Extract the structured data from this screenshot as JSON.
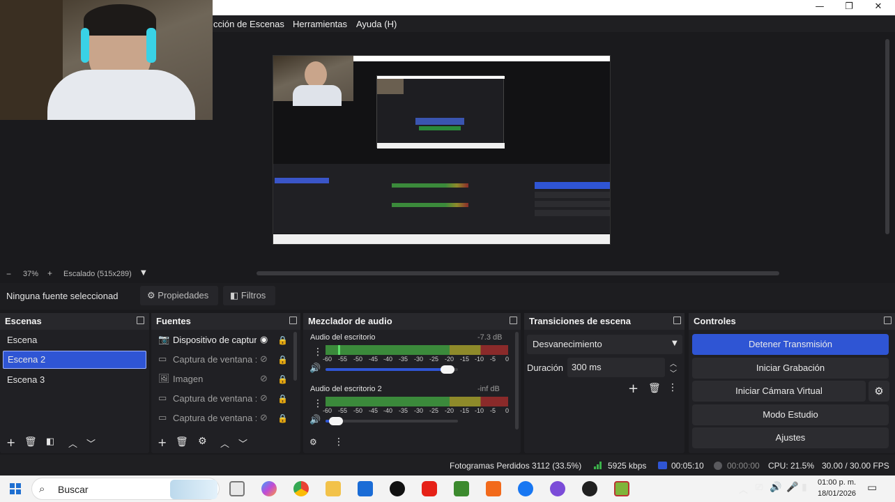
{
  "window": {
    "minimize": "—",
    "restore": "❐",
    "close": "✕"
  },
  "menu": {
    "items": [
      "cción de Escenas",
      "Herramientas",
      "Ayuda (H)"
    ]
  },
  "zoom": {
    "minus": "−",
    "level": "37%",
    "plus": "+",
    "scale": "Escalado (515x289)"
  },
  "source_toolbar": {
    "selected": "Ninguna fuente seleccionad",
    "properties": "Propiedades",
    "filters": "Filtros"
  },
  "scenes": {
    "title": "Escenas",
    "items": [
      "Escena",
      "Escena 2",
      "Escena 3"
    ],
    "selected_index": 1
  },
  "sources": {
    "title": "Fuentes",
    "items": [
      {
        "label": "Dispositivo de captur",
        "icon": "camera-icon",
        "visible": true
      },
      {
        "label": "Captura de ventana :",
        "icon": "window-icon",
        "visible": false
      },
      {
        "label": "Imagen",
        "icon": "image-icon",
        "visible": false
      },
      {
        "label": "Captura de ventana :",
        "icon": "window-icon",
        "visible": false
      },
      {
        "label": "Captura de ventana :",
        "icon": "window-icon",
        "visible": false
      }
    ]
  },
  "mixer": {
    "title": "Mezclador de audio",
    "channels": [
      {
        "name": "Audio del escritorio",
        "db": "-7.3 dB",
        "level": 0.07,
        "volume": 0.92
      },
      {
        "name": "Audio del escritorio 2",
        "db": "-inf dB",
        "level": 0.0,
        "volume": 0.08
      }
    ],
    "scale": [
      "-60",
      "-55",
      "-50",
      "-45",
      "-40",
      "-35",
      "-30",
      "-25",
      "-20",
      "-15",
      "-10",
      "-5",
      "0"
    ]
  },
  "transitions": {
    "title": "Transiciones de escena",
    "selected": "Desvanecimiento",
    "duration_label": "Duración",
    "duration_value": "300 ms"
  },
  "controls": {
    "title": "Controles",
    "buttons": [
      "Detener Transmisión",
      "Iniciar Grabación",
      "Iniciar Cámara Virtual",
      "Modo Estudio",
      "Ajustes"
    ]
  },
  "status": {
    "dropped": "Fotogramas Perdidos 3112 (33.5%)",
    "bitrate": "5925 kbps",
    "stream_time": "00:05:10",
    "rec_time": "00:00:00",
    "cpu": "CPU: 21.5%",
    "fps": "30.00 / 30.00 FPS"
  },
  "taskbar": {
    "search": "Buscar",
    "time": "01:00 p. m.",
    "date": "18/01/2026"
  },
  "colors": {
    "accent": "#2f55d4",
    "meter_green": "#3b8a3b",
    "meter_yellow": "#8e8a2a",
    "meter_red": "#8a2a2a"
  }
}
